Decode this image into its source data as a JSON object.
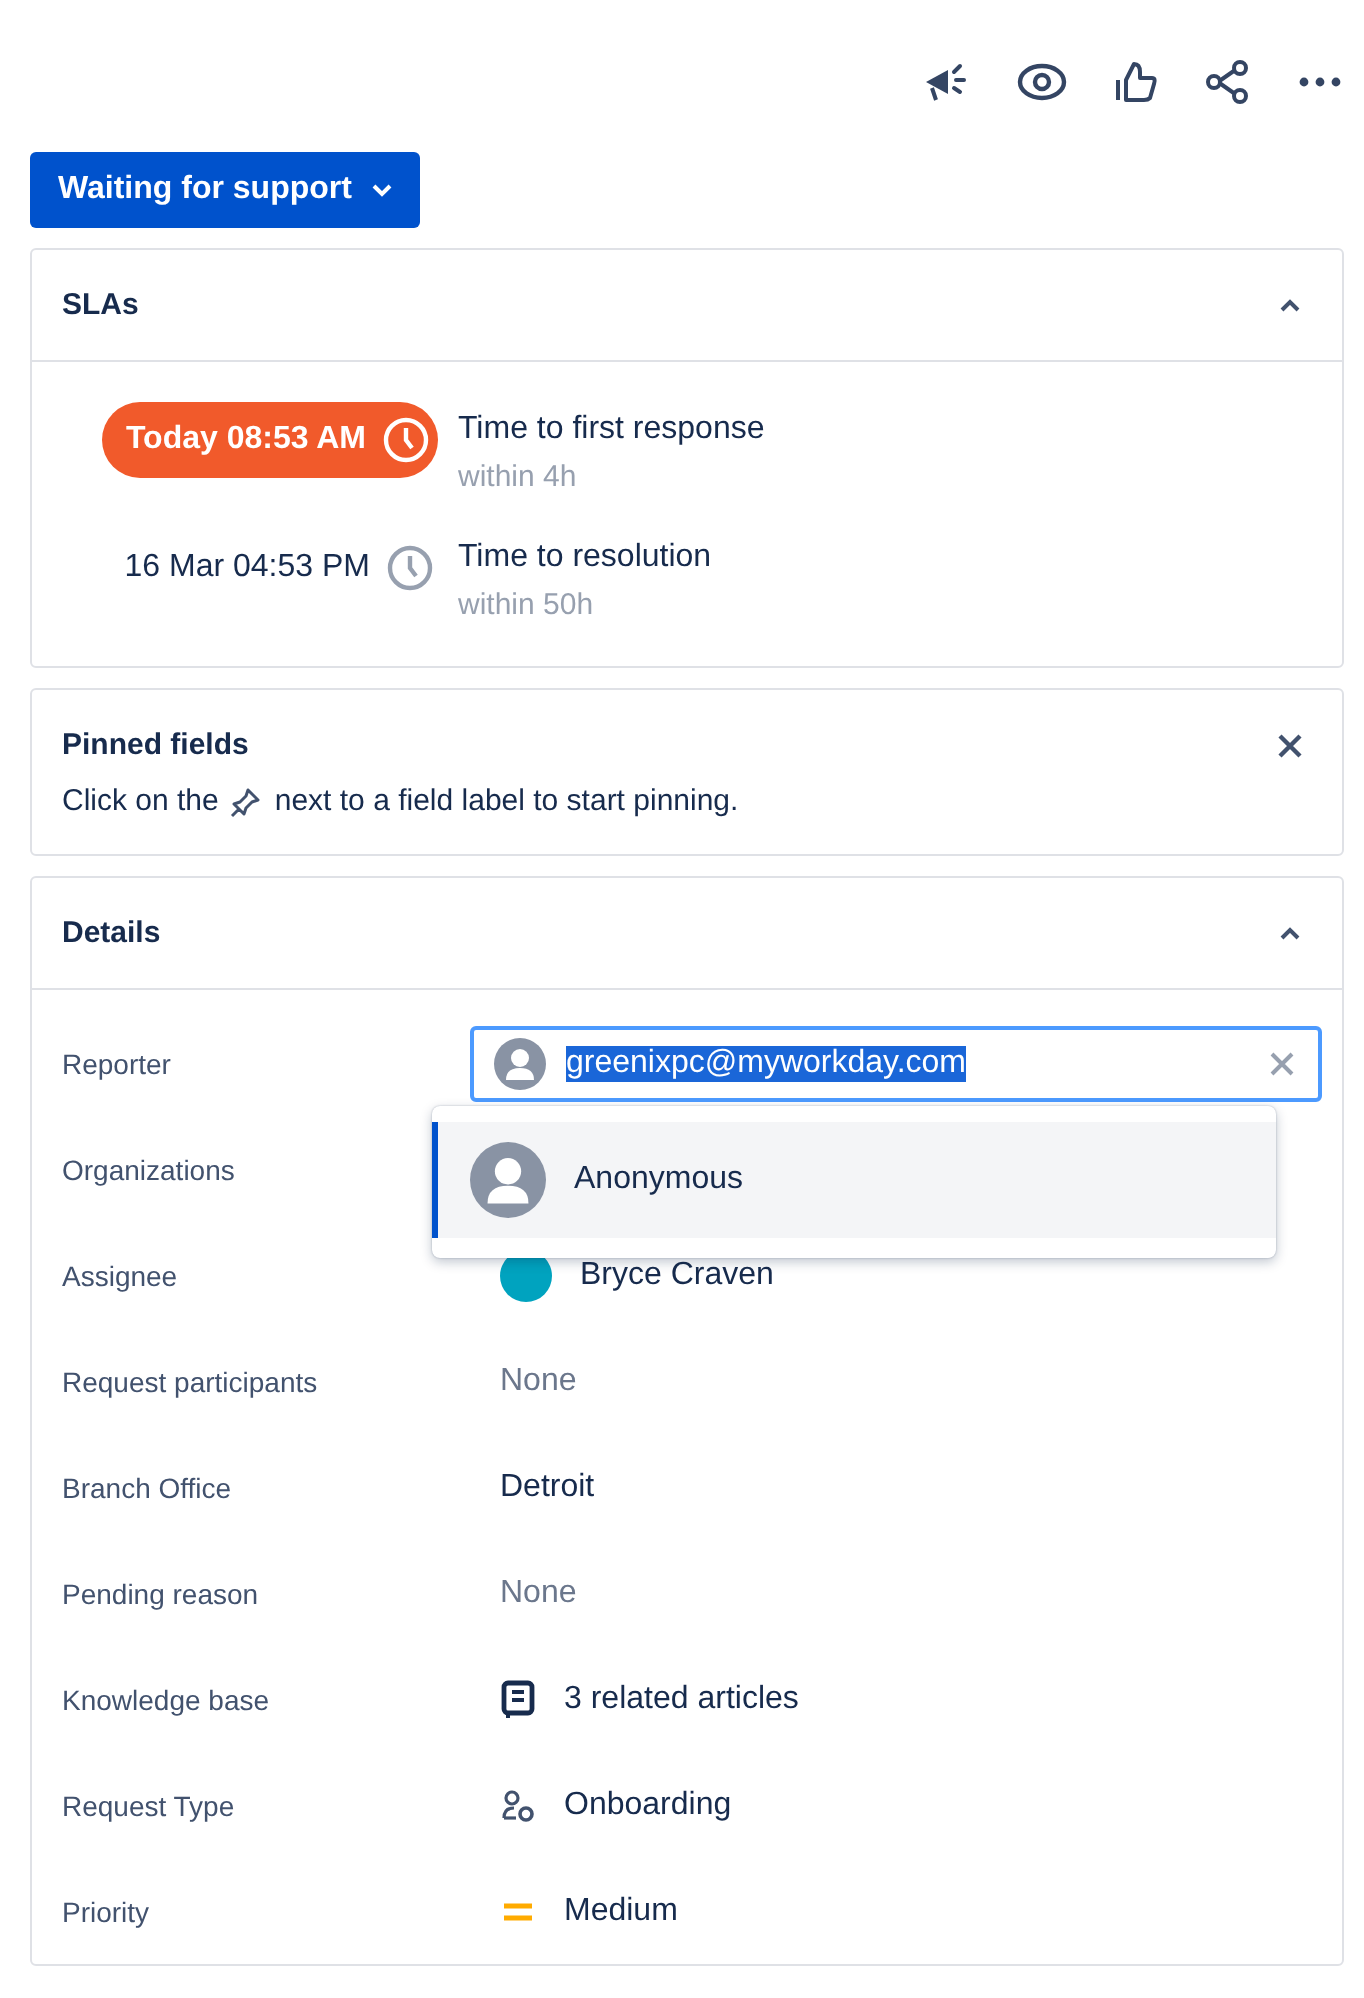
{
  "status_button": {
    "label": "Waiting for support"
  },
  "slas": {
    "title": "SLAs",
    "expanded": true,
    "items": [
      {
        "time": "Today 08:53 AM",
        "breached": true,
        "name": "Time to first response",
        "goal": "within 4h"
      },
      {
        "time": "16 Mar 04:53 PM",
        "breached": false,
        "name": "Time to resolution",
        "goal": "within 50h"
      }
    ]
  },
  "pinned_fields": {
    "title": "Pinned fields",
    "hint_before": "Click on the",
    "hint_after": "next to a field label to start pinning."
  },
  "details": {
    "title": "Details",
    "expanded": true,
    "fields": [
      {
        "label": "Reporter",
        "kind": "user-input",
        "value": "greenixpc@myworkday.com"
      },
      {
        "label": "Organizations"
      },
      {
        "label": "Assignee",
        "kind": "user",
        "value": "Bryce Craven"
      },
      {
        "label": "Request participants",
        "kind": "empty",
        "value": "None"
      },
      {
        "label": "Branch Office",
        "kind": "text",
        "value": "Detroit"
      },
      {
        "label": "Pending reason",
        "kind": "empty",
        "value": "None"
      },
      {
        "label": "Knowledge base",
        "kind": "articles",
        "value": "3 related articles"
      },
      {
        "label": "Request Type",
        "kind": "request-type",
        "value": "Onboarding"
      },
      {
        "label": "Priority",
        "kind": "priority",
        "value": "Medium"
      }
    ]
  },
  "reporter_dropdown": {
    "options": [
      {
        "label": "Anonymous",
        "selected": true
      }
    ]
  }
}
